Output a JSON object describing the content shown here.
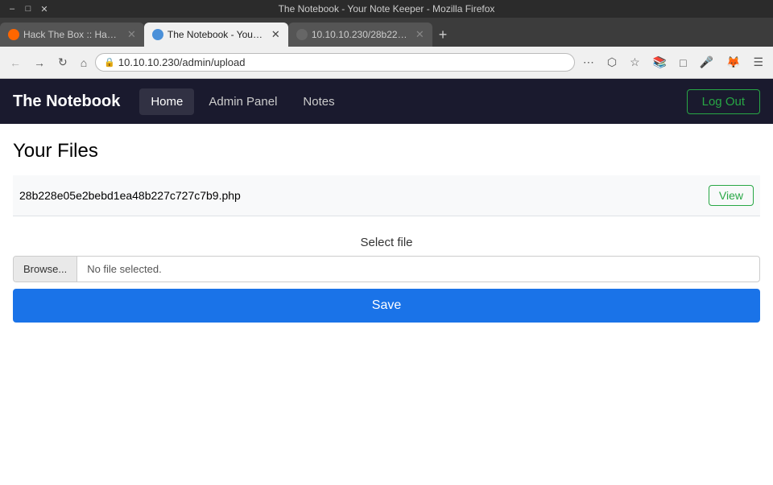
{
  "browser": {
    "title": "The Notebook - Your Note Keeper - Mozilla Firefox",
    "window_controls": [
      "–",
      "□",
      "✕"
    ],
    "tabs": [
      {
        "id": "tab1",
        "label": "Hack The Box :: Hack The",
        "active": false,
        "icon_color": "#ff6600"
      },
      {
        "id": "tab2",
        "label": "The Notebook - Your No",
        "active": true,
        "icon_color": "#4a90d9"
      },
      {
        "id": "tab3",
        "label": "10.10.10.230/28b228e05e2",
        "active": false,
        "icon_color": "#666"
      }
    ],
    "address": "10.10.10.230/admin/upload"
  },
  "navbar": {
    "brand": "The Notebook",
    "links": [
      {
        "label": "Home",
        "active": true
      },
      {
        "label": "Admin Panel",
        "active": false
      },
      {
        "label": "Notes",
        "active": false
      }
    ],
    "logout_label": "Log Out"
  },
  "page": {
    "title": "Your Files",
    "files": [
      {
        "name": "28b228e05e2bebd1ea48b227c727c7b9.php",
        "view_label": "View"
      }
    ],
    "upload": {
      "label": "Select file",
      "browse_label": "Browse...",
      "no_file_text": "No file selected.",
      "save_label": "Save"
    }
  }
}
